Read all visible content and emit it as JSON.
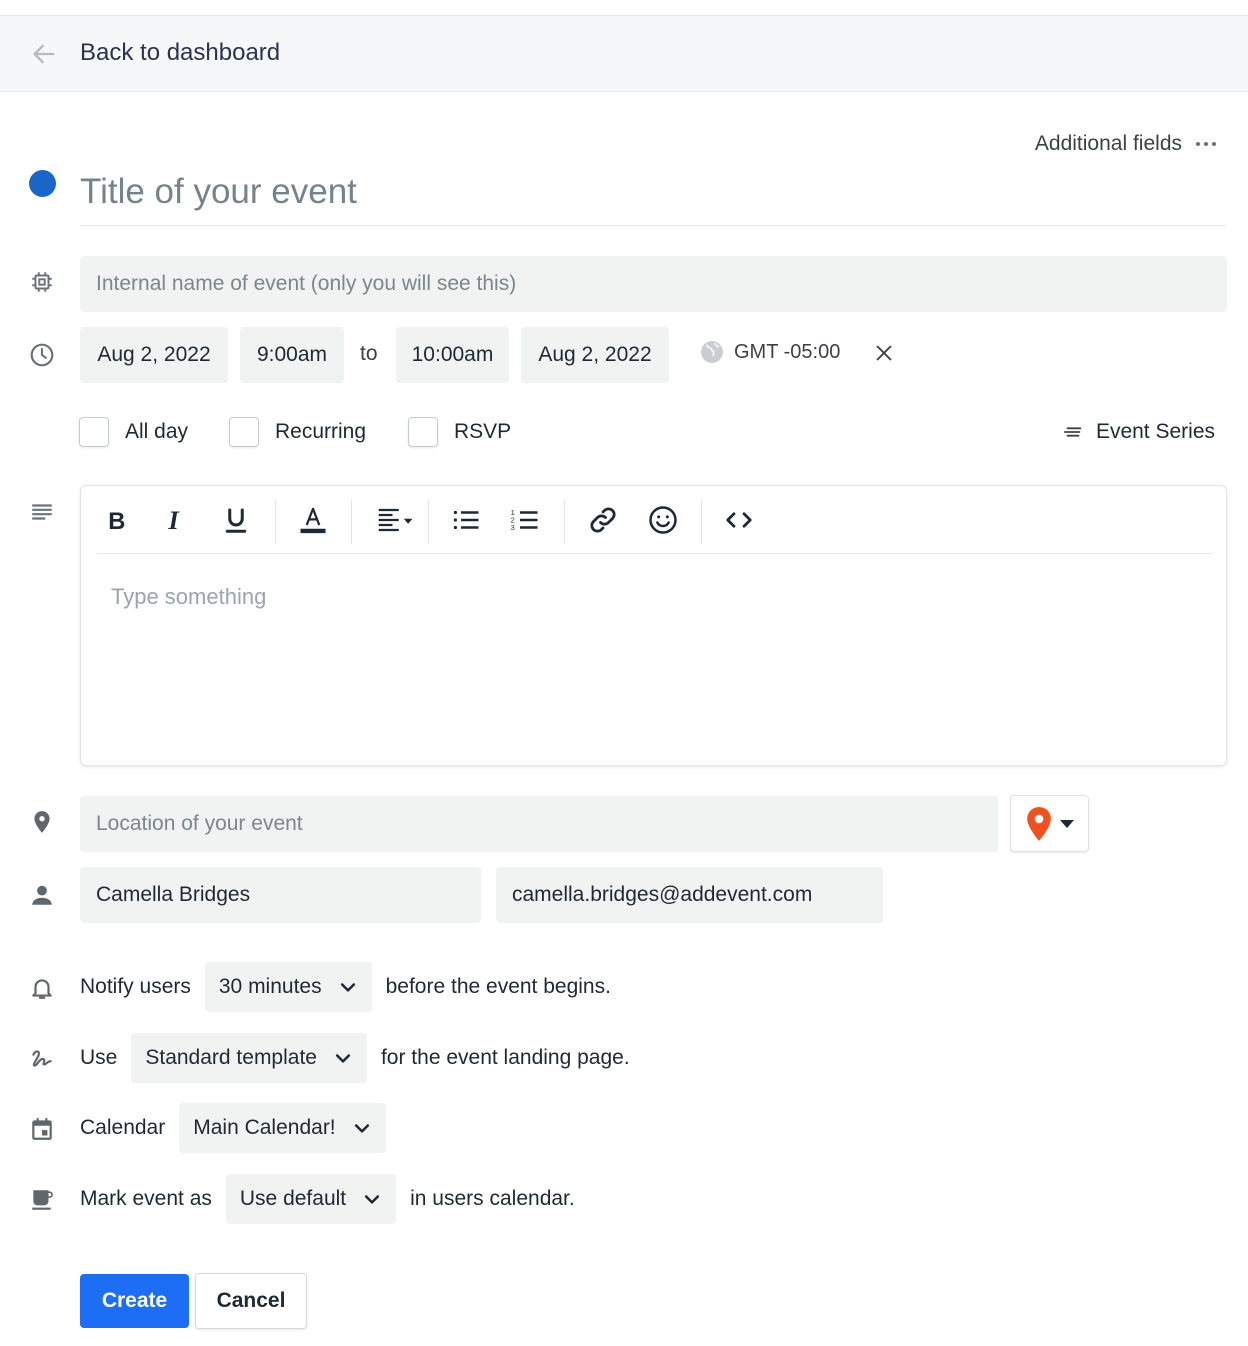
{
  "header": {
    "back_label": "Back to dashboard"
  },
  "additional_fields": {
    "label": "Additional fields"
  },
  "event": {
    "color": "#1a66c8",
    "title_placeholder": "Title of your event",
    "internal_name_placeholder": "Internal name of event (only you will see this)"
  },
  "datetime": {
    "start_date": "Aug 2, 2022",
    "start_time": "9:00am",
    "to_label": "to",
    "end_time": "10:00am",
    "end_date": "Aug 2, 2022",
    "timezone": "GMT -05:00"
  },
  "options": {
    "all_day": "All day",
    "recurring": "Recurring",
    "rsvp": "RSVP",
    "event_series": "Event Series"
  },
  "editor": {
    "placeholder": "Type something"
  },
  "location": {
    "placeholder": "Location of your event"
  },
  "organizer": {
    "name": "Camella Bridges",
    "email": "camella.bridges@addevent.com"
  },
  "notify": {
    "prefix": "Notify users",
    "value": "30 minutes",
    "suffix": "before the event begins."
  },
  "template": {
    "prefix": "Use",
    "value": "Standard template",
    "suffix": "for the event landing page."
  },
  "calendar": {
    "prefix": "Calendar",
    "value": "Main Calendar!"
  },
  "mark": {
    "prefix": "Mark event as",
    "value": "Use default",
    "suffix": "in users calendar."
  },
  "actions": {
    "create": "Create",
    "cancel": "Cancel"
  },
  "colors": {
    "accent": "#1d6ef5",
    "location_pin": "#f0521f"
  }
}
